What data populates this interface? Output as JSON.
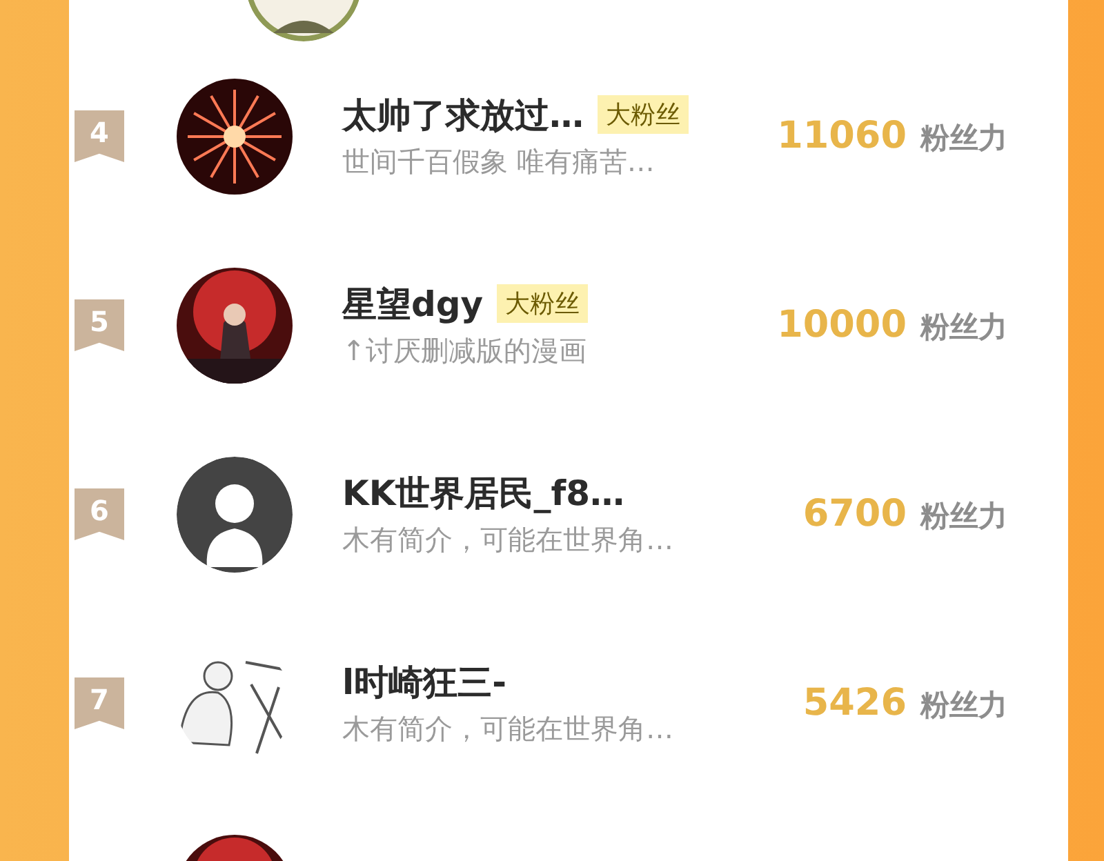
{
  "top_avatar": {
    "kind": "ring"
  },
  "fans": [
    {
      "rank": "4",
      "name": "太帅了求放过…",
      "badge": "大粉丝",
      "bio": "世间千百假象 唯有痛苦…",
      "score": "11060",
      "unit": "粉丝力",
      "avatar": {
        "kind": "firework"
      }
    },
    {
      "rank": "5",
      "name": "星望dgy",
      "badge": "大粉丝",
      "bio": "↑讨厌删减版的漫画",
      "score": "10000",
      "unit": "粉丝力",
      "avatar": {
        "kind": "moon"
      }
    },
    {
      "rank": "6",
      "name": "KK世界居民_f8…",
      "bio": "木有简介，可能在世界角…",
      "score": "6700",
      "unit": "粉丝力",
      "avatar": {
        "kind": "default"
      }
    },
    {
      "rank": "7",
      "name": "l时崎狂三-",
      "bio": "木有简介，可能在世界角…",
      "score": "5426",
      "unit": "粉丝力",
      "avatar": {
        "kind": "doodle"
      }
    },
    {
      "avatar": {
        "kind": "moon"
      }
    }
  ]
}
